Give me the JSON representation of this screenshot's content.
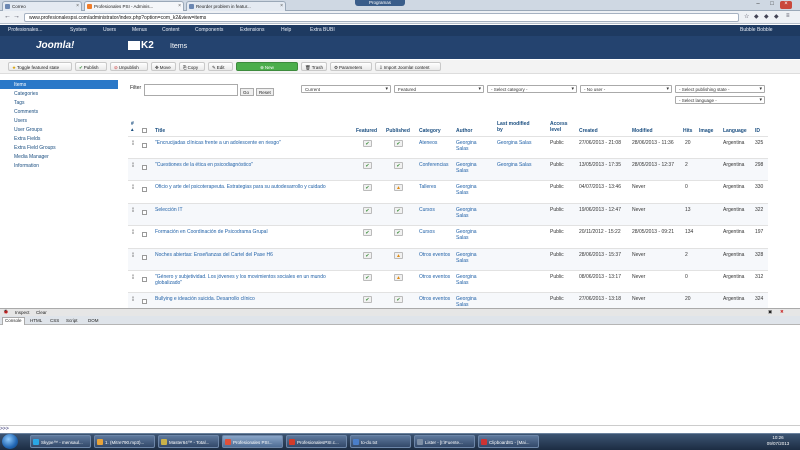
{
  "browser": {
    "tabs": [
      {
        "label": "Correo"
      },
      {
        "label": "Profesionales PSI - Adminis..."
      },
      {
        "label": "Reorder problem in featur..."
      }
    ],
    "programs_badge": "Programas",
    "url": "www.profesionalespsi.com/administrator/index.php?option=com_k2&view=items"
  },
  "admin_menu": {
    "site_name": "Profesionales...",
    "items": [
      "System",
      "Users",
      "Menus",
      "Content",
      "Components",
      "Extensions",
      "Help",
      "Extra BUBI"
    ],
    "user": "Bubble Bobble"
  },
  "branding": {
    "joomla": "Joomla!",
    "k2": "K2",
    "page_title": "Items"
  },
  "toolbar": {
    "toggle_featured": "Toggle featured state",
    "publish": "Publish",
    "unpublish": "Unpublish",
    "move": "Move",
    "copy": "Copy",
    "edit": "Edit",
    "new": "New",
    "trash": "Trash",
    "parameters": "Parameters",
    "import": "Import Joomla! content"
  },
  "sidebar": {
    "items": [
      "Items",
      "Categories",
      "Tags",
      "Comments",
      "Users",
      "User Groups",
      "Extra Fields",
      "Extra Field Groups",
      "Media Manager",
      "Information"
    ],
    "active_index": 0
  },
  "filters": {
    "label": "Filter",
    "search_value": "",
    "go": "Go",
    "reset": "Reset",
    "status": "Current",
    "featured": "Featured",
    "category": "- Select category -",
    "user": "- No user -",
    "publishing": "- Select publishing state -",
    "language": "- Select language -"
  },
  "table": {
    "columns": {
      "order": "#",
      "title": "Title",
      "featured": "Featured",
      "published": "Published",
      "category": "Category",
      "author": "Author",
      "last_modified_by": "Last modified by",
      "access": "Access level",
      "created": "Created",
      "modified": "Modified",
      "hits": "Hits",
      "image": "Image",
      "language": "Language",
      "id": "ID"
    },
    "rows": [
      {
        "title": "\"Encrucijadas clínicas frente a un adolescente en riesgo\"",
        "featured": "ok",
        "published": "ok",
        "category": "Ateneos",
        "author": "Georgina Salas",
        "modified_by": "Georgina Salas",
        "access": "Public",
        "created": "27/06/2013 - 21:08",
        "modified": "28/06/2013 - 11:36",
        "hits": "20",
        "language": "Argentina",
        "id": "325"
      },
      {
        "title": "\"Cuestiones de la ética en psicodiagnóstico\"",
        "featured": "ok",
        "published": "ok",
        "category": "Conferencias",
        "author": "Georgina Salas",
        "modified_by": "Georgina Salas",
        "access": "Public",
        "created": "13/05/2013 - 17:35",
        "modified": "28/05/2013 - 12:37",
        "hits": "2",
        "language": "Argentina",
        "id": "298"
      },
      {
        "title": "Oficio y arte del psicoterapeuta. Estrategias para su autodesarrollo y cuidado",
        "featured": "ok",
        "published": "warn",
        "category": "Talleres",
        "author": "Georgina Salas",
        "modified_by": "",
        "access": "Public",
        "created": "04/07/2013 - 13:46",
        "modified": "Never",
        "hits": "0",
        "language": "Argentina",
        "id": "330"
      },
      {
        "title": "Selección IT",
        "featured": "ok",
        "published": "ok",
        "category": "Cursos",
        "author": "Georgina Salas",
        "modified_by": "",
        "access": "Public",
        "created": "19/06/2013 - 12:47",
        "modified": "Never",
        "hits": "13",
        "language": "Argentina",
        "id": "322"
      },
      {
        "title": "Formación en Coordinación de Psicodrama Grupal",
        "featured": "ok",
        "published": "ok",
        "category": "Cursos",
        "author": "Georgina Salas",
        "modified_by": "",
        "access": "Public",
        "created": "20/11/2012 - 15:22",
        "modified": "28/05/2013 - 09:21",
        "hits": "134",
        "language": "Argentina",
        "id": "197"
      },
      {
        "title": "Noches abiertas: Enseñanzas del Cartel del Pase H6",
        "featured": "ok",
        "published": "warn",
        "category": "Otros eventos",
        "author": "Georgina Salas",
        "modified_by": "",
        "access": "Public",
        "created": "28/06/2013 - 15:37",
        "modified": "Never",
        "hits": "2",
        "language": "Argentina",
        "id": "328"
      },
      {
        "title": "\"Género y subjetividad. Los jóvenes y los movimientos sociales en un mundo globalizado\"",
        "featured": "ok",
        "published": "warn",
        "category": "Otros eventos",
        "author": "Georgina Salas",
        "modified_by": "",
        "access": "Public",
        "created": "08/06/2013 - 13:17",
        "modified": "Never",
        "hits": "0",
        "language": "Argentina",
        "id": "312"
      },
      {
        "title": "Bullying e ideación suicida. Desarrollo clínico",
        "featured": "ok",
        "published": "ok",
        "category": "Otros eventos",
        "author": "Georgina Salas",
        "modified_by": "",
        "access": "Public",
        "created": "27/06/2013 - 13:18",
        "modified": "Never",
        "hits": "20",
        "language": "Argentina",
        "id": "324"
      }
    ]
  },
  "firebug": {
    "inspect": "Inspect",
    "clear": "Clear",
    "tabs": [
      "Console",
      "HTML",
      "CSS",
      "Script",
      "DOM"
    ],
    "prompt": ">>>"
  },
  "taskbar": {
    "items": [
      {
        "label": "Skype™ - mensaul...",
        "color": "#2aa7e6"
      },
      {
        "label": "1. (Mitre790.mp3)...",
        "color": "#e8a33a"
      },
      {
        "label": "Master64™ - Total...",
        "color": "#c9b24a"
      },
      {
        "label": "Profesionales PSI...",
        "color": "#e0503a"
      },
      {
        "label": "ProfesionalesPSI.c...",
        "color": "#d23b2a"
      },
      {
        "label": "to-do.txt",
        "color": "#4a7ec9"
      },
      {
        "label": "Lister - [I:\\Fuente...",
        "color": "#7d8fa6"
      },
      {
        "label": "Clipboard81 - [Mai...",
        "color": "#c33"
      }
    ],
    "time": "10:26",
    "date": "09/07/2013"
  }
}
